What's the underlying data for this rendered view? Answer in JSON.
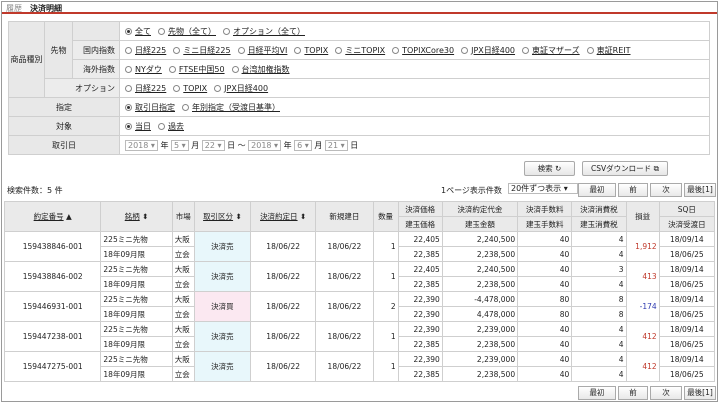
{
  "header": {
    "section": "履歴",
    "title": "決済明細"
  },
  "filters": {
    "product_type_label": "商品種別",
    "futures_label": "先物",
    "domestic_label": "国内指数",
    "overseas_label": "海外指数",
    "option_label": "オプション",
    "top_options": [
      {
        "label": "全て",
        "on": true
      },
      {
        "label": "先物（全て）",
        "on": false
      },
      {
        "label": "オプション（全て）",
        "on": false
      }
    ],
    "domestic_options": [
      "日経225",
      "ミニ日経225",
      "日経平均VI",
      "TOPIX",
      "ミニTOPIX",
      "TOPIXCore30",
      "JPX日経400",
      "東証マザーズ",
      "東証REIT"
    ],
    "overseas_options": [
      "NYダウ",
      "FTSE中国50",
      "台湾加権指数"
    ],
    "option_options": [
      "日経225",
      "TOPIX",
      "JPX日経400"
    ],
    "spec_label": "指定",
    "spec_options": [
      {
        "label": "取引日指定",
        "on": true
      },
      {
        "label": "年別指定（受渡日基準）",
        "on": false
      }
    ],
    "target_label": "対象",
    "target_options": [
      {
        "label": "当日",
        "on": true
      },
      {
        "label": "過去",
        "on": false
      }
    ],
    "tradedate_label": "取引日",
    "from": {
      "year": "2018",
      "year_unit": "年",
      "month": "5",
      "month_unit": "月",
      "day": "22",
      "day_unit": "日"
    },
    "tilde": "〜",
    "to": {
      "year": "2018",
      "year_unit": "年",
      "month": "6",
      "month_unit": "月",
      "day": "21",
      "day_unit": "日"
    }
  },
  "actions": {
    "search": "検索",
    "csv": "CSVダウンロード"
  },
  "results": {
    "count": "検索件数：5 件",
    "per_page_label": "1ページ表示件数",
    "per_page_value": "20件ずつ表示"
  },
  "pager": {
    "first": "最初",
    "prev": "前",
    "next": "次",
    "last": "最後[1]"
  },
  "table": {
    "headers": {
      "order_no": "約定番号",
      "symbol": "銘柄",
      "market": "市場",
      "trade_type": "取引区分",
      "exec_date": "決済約定日",
      "new_date": "新規建日",
      "qty": "数量",
      "price": "決済価格",
      "build_price": "建玉価格",
      "amount": "決済約定代金",
      "build_amount": "建玉金額",
      "fee": "決済手数料",
      "build_fee": "建玉手数料",
      "tax": "決済消費税",
      "build_tax": "建玉消費税",
      "pl": "損益",
      "sq": "SQ日",
      "delivery": "決済受渡日"
    },
    "rows": [
      {
        "no": "159438846-001",
        "sym1": "225ミニ先物",
        "sym2": "18年09月限",
        "m1": "大阪",
        "m2": "立会",
        "type": "決済売",
        "type_kind": "sell",
        "exec": "18/06/22",
        "new": "18/06/22",
        "qty": "1",
        "p1": "22,405",
        "p2": "22,385",
        "a1": "2,240,500",
        "a2": "2,238,500",
        "f1": "40",
        "f2": "40",
        "t1": "4",
        "t2": "4",
        "pl": "1,912",
        "pl_kind": "pos",
        "sq": "18/09/14",
        "dl": "18/06/25"
      },
      {
        "no": "159438846-002",
        "sym1": "225ミニ先物",
        "sym2": "18年09月限",
        "m1": "大阪",
        "m2": "立会",
        "type": "決済売",
        "type_kind": "sell",
        "exec": "18/06/22",
        "new": "18/06/22",
        "qty": "1",
        "p1": "22,405",
        "p2": "22,385",
        "a1": "2,240,500",
        "a2": "2,238,500",
        "f1": "40",
        "f2": "40",
        "t1": "3",
        "t2": "4",
        "pl": "413",
        "pl_kind": "pos",
        "sq": "18/09/14",
        "dl": "18/06/25"
      },
      {
        "no": "159446931-001",
        "sym1": "225ミニ先物",
        "sym2": "18年09月限",
        "m1": "大阪",
        "m2": "立会",
        "type": "決済買",
        "type_kind": "buy",
        "exec": "18/06/22",
        "new": "18/06/22",
        "qty": "2",
        "p1": "22,390",
        "p2": "22,390",
        "a1": "-4,478,000",
        "a2": "4,478,000",
        "f1": "80",
        "f2": "80",
        "t1": "8",
        "t2": "8",
        "pl": "-174",
        "pl_kind": "neg",
        "sq": "18/09/14",
        "dl": "18/06/25"
      },
      {
        "no": "159447238-001",
        "sym1": "225ミニ先物",
        "sym2": "18年09月限",
        "m1": "大阪",
        "m2": "立会",
        "type": "決済売",
        "type_kind": "sell",
        "exec": "18/06/22",
        "new": "18/06/22",
        "qty": "1",
        "p1": "22,390",
        "p2": "22,385",
        "a1": "2,239,000",
        "a2": "2,238,500",
        "f1": "40",
        "f2": "40",
        "t1": "4",
        "t2": "4",
        "pl": "412",
        "pl_kind": "pos",
        "sq": "18/09/14",
        "dl": "18/06/25"
      },
      {
        "no": "159447275-001",
        "sym1": "225ミニ先物",
        "sym2": "18年09月限",
        "m1": "大阪",
        "m2": "立会",
        "type": "決済売",
        "type_kind": "sell",
        "exec": "18/06/22",
        "new": "18/06/22",
        "qty": "1",
        "p1": "22,390",
        "p2": "22,385",
        "a1": "2,239,000",
        "a2": "2,238,500",
        "f1": "40",
        "f2": "40",
        "t1": "4",
        "t2": "4",
        "pl": "412",
        "pl_kind": "pos",
        "sq": "18/09/14",
        "dl": "18/06/25"
      }
    ]
  },
  "colors": {
    "accent": "#c0392b",
    "positive": "#c0392b",
    "negative": "#2f3bb0",
    "sell_bg": "#e8f7fb",
    "buy_bg": "#fbe8f1"
  }
}
